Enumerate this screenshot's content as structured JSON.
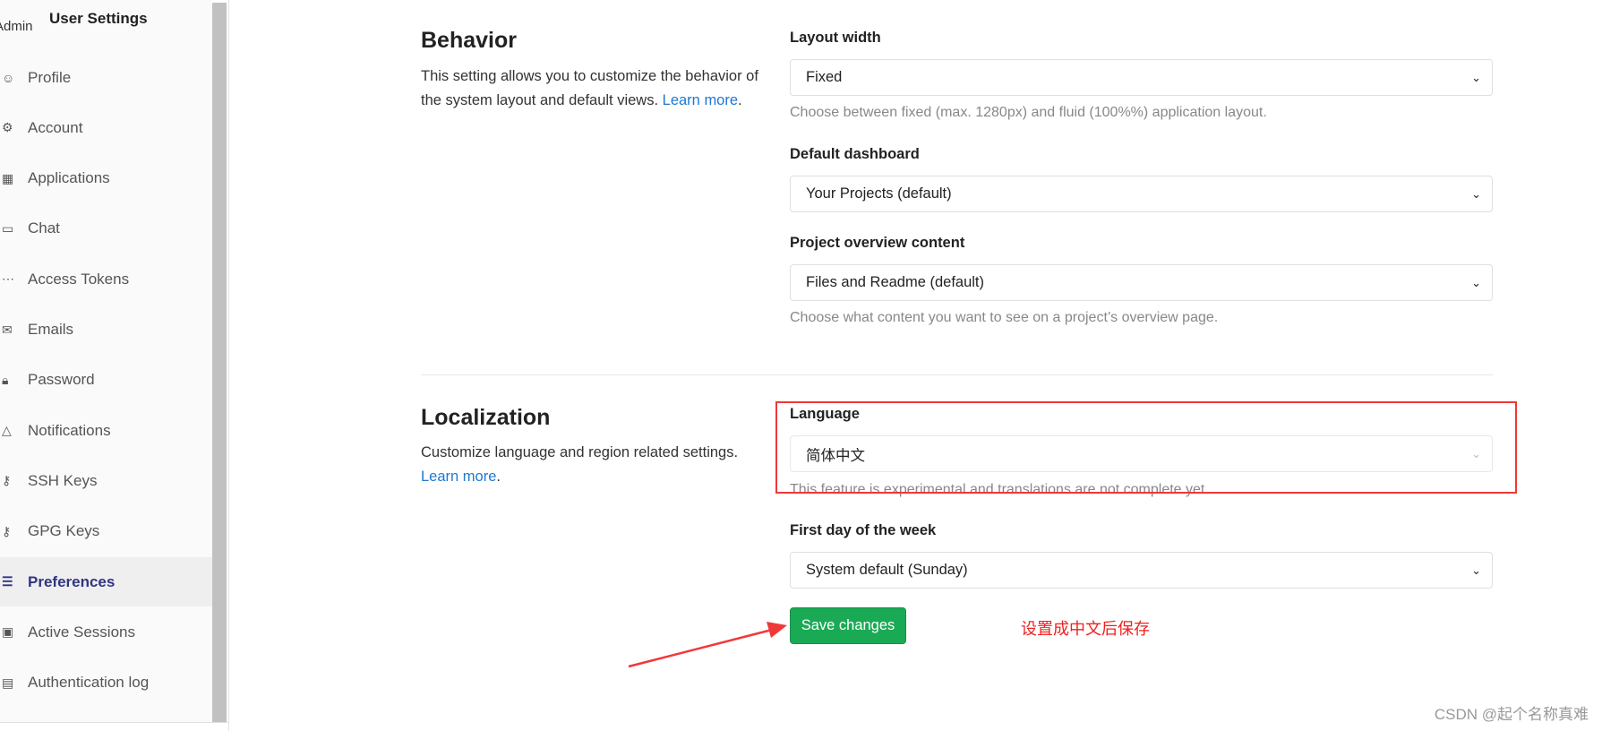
{
  "sidebar": {
    "avatar_alt": "Admin",
    "title": "User Settings",
    "items": [
      {
        "label": "Profile",
        "icon": "profile-icon",
        "glyph": "☺"
      },
      {
        "label": "Account",
        "icon": "account-icon",
        "glyph": "⚙"
      },
      {
        "label": "Applications",
        "icon": "applications-icon",
        "glyph": "▦"
      },
      {
        "label": "Chat",
        "icon": "chat-icon",
        "glyph": "▭"
      },
      {
        "label": "Access Tokens",
        "icon": "token-icon",
        "glyph": "⋯"
      },
      {
        "label": "Emails",
        "icon": "email-icon",
        "glyph": "✉"
      },
      {
        "label": "Password",
        "icon": "lock-icon",
        "glyph": "🔒︎"
      },
      {
        "label": "Notifications",
        "icon": "bell-icon",
        "glyph": "△"
      },
      {
        "label": "SSH Keys",
        "icon": "key-icon",
        "glyph": "⚷"
      },
      {
        "label": "GPG Keys",
        "icon": "key-icon",
        "glyph": "⚷"
      },
      {
        "label": "Preferences",
        "icon": "preferences-icon",
        "glyph": "☰",
        "active": true
      },
      {
        "label": "Active Sessions",
        "icon": "monitor-icon",
        "glyph": "▣"
      },
      {
        "label": "Authentication log",
        "icon": "log-icon",
        "glyph": "▤"
      }
    ]
  },
  "behavior": {
    "title": "Behavior",
    "description": "This setting allows you to customize the behavior of the system layout and default views.",
    "learn_more": "Learn more",
    "layout_width": {
      "label": "Layout width",
      "value": "Fixed",
      "help": "Choose between fixed (max. 1280px) and fluid (100%%) application layout."
    },
    "default_dashboard": {
      "label": "Default dashboard",
      "value": "Your Projects (default)"
    },
    "project_overview": {
      "label": "Project overview content",
      "value": "Files and Readme (default)",
      "help": "Choose what content you want to see on a project’s overview page."
    }
  },
  "localization": {
    "title": "Localization",
    "description": "Customize language and region related settings.",
    "learn_more": "Learn more",
    "language": {
      "label": "Language",
      "value": "简体中文",
      "help": "This feature is experimental and translations are not complete yet"
    },
    "first_day": {
      "label": "First day of the week",
      "value": "System default (Sunday)"
    }
  },
  "save_label": "Save changes",
  "annotation": {
    "note": "设置成中文后保存",
    "color": "#f03838"
  },
  "watermark": "CSDN @起个名称真难",
  "colors": {
    "accent": "#1aaa55",
    "active_nav": "#303680",
    "link": "#1f78d1"
  }
}
